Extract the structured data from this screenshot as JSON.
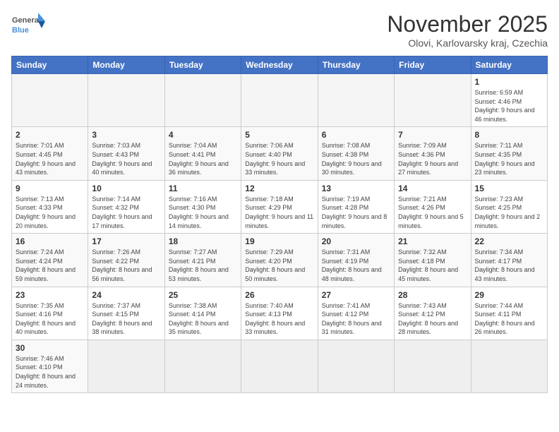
{
  "header": {
    "logo_general": "General",
    "logo_blue": "Blue",
    "month": "November 2025",
    "location": "Olovi, Karlovarsky kraj, Czechia"
  },
  "days_of_week": [
    "Sunday",
    "Monday",
    "Tuesday",
    "Wednesday",
    "Thursday",
    "Friday",
    "Saturday"
  ],
  "weeks": [
    [
      {
        "day": "",
        "info": ""
      },
      {
        "day": "",
        "info": ""
      },
      {
        "day": "",
        "info": ""
      },
      {
        "day": "",
        "info": ""
      },
      {
        "day": "",
        "info": ""
      },
      {
        "day": "",
        "info": ""
      },
      {
        "day": "1",
        "info": "Sunrise: 6:59 AM\nSunset: 4:46 PM\nDaylight: 9 hours and 46 minutes."
      }
    ],
    [
      {
        "day": "2",
        "info": "Sunrise: 7:01 AM\nSunset: 4:45 PM\nDaylight: 9 hours and 43 minutes."
      },
      {
        "day": "3",
        "info": "Sunrise: 7:03 AM\nSunset: 4:43 PM\nDaylight: 9 hours and 40 minutes."
      },
      {
        "day": "4",
        "info": "Sunrise: 7:04 AM\nSunset: 4:41 PM\nDaylight: 9 hours and 36 minutes."
      },
      {
        "day": "5",
        "info": "Sunrise: 7:06 AM\nSunset: 4:40 PM\nDaylight: 9 hours and 33 minutes."
      },
      {
        "day": "6",
        "info": "Sunrise: 7:08 AM\nSunset: 4:38 PM\nDaylight: 9 hours and 30 minutes."
      },
      {
        "day": "7",
        "info": "Sunrise: 7:09 AM\nSunset: 4:36 PM\nDaylight: 9 hours and 27 minutes."
      },
      {
        "day": "8",
        "info": "Sunrise: 7:11 AM\nSunset: 4:35 PM\nDaylight: 9 hours and 23 minutes."
      }
    ],
    [
      {
        "day": "9",
        "info": "Sunrise: 7:13 AM\nSunset: 4:33 PM\nDaylight: 9 hours and 20 minutes."
      },
      {
        "day": "10",
        "info": "Sunrise: 7:14 AM\nSunset: 4:32 PM\nDaylight: 9 hours and 17 minutes."
      },
      {
        "day": "11",
        "info": "Sunrise: 7:16 AM\nSunset: 4:30 PM\nDaylight: 9 hours and 14 minutes."
      },
      {
        "day": "12",
        "info": "Sunrise: 7:18 AM\nSunset: 4:29 PM\nDaylight: 9 hours and 11 minutes."
      },
      {
        "day": "13",
        "info": "Sunrise: 7:19 AM\nSunset: 4:28 PM\nDaylight: 9 hours and 8 minutes."
      },
      {
        "day": "14",
        "info": "Sunrise: 7:21 AM\nSunset: 4:26 PM\nDaylight: 9 hours and 5 minutes."
      },
      {
        "day": "15",
        "info": "Sunrise: 7:23 AM\nSunset: 4:25 PM\nDaylight: 9 hours and 2 minutes."
      }
    ],
    [
      {
        "day": "16",
        "info": "Sunrise: 7:24 AM\nSunset: 4:24 PM\nDaylight: 8 hours and 59 minutes."
      },
      {
        "day": "17",
        "info": "Sunrise: 7:26 AM\nSunset: 4:22 PM\nDaylight: 8 hours and 56 minutes."
      },
      {
        "day": "18",
        "info": "Sunrise: 7:27 AM\nSunset: 4:21 PM\nDaylight: 8 hours and 53 minutes."
      },
      {
        "day": "19",
        "info": "Sunrise: 7:29 AM\nSunset: 4:20 PM\nDaylight: 8 hours and 50 minutes."
      },
      {
        "day": "20",
        "info": "Sunrise: 7:31 AM\nSunset: 4:19 PM\nDaylight: 8 hours and 48 minutes."
      },
      {
        "day": "21",
        "info": "Sunrise: 7:32 AM\nSunset: 4:18 PM\nDaylight: 8 hours and 45 minutes."
      },
      {
        "day": "22",
        "info": "Sunrise: 7:34 AM\nSunset: 4:17 PM\nDaylight: 8 hours and 43 minutes."
      }
    ],
    [
      {
        "day": "23",
        "info": "Sunrise: 7:35 AM\nSunset: 4:16 PM\nDaylight: 8 hours and 40 minutes."
      },
      {
        "day": "24",
        "info": "Sunrise: 7:37 AM\nSunset: 4:15 PM\nDaylight: 8 hours and 38 minutes."
      },
      {
        "day": "25",
        "info": "Sunrise: 7:38 AM\nSunset: 4:14 PM\nDaylight: 8 hours and 35 minutes."
      },
      {
        "day": "26",
        "info": "Sunrise: 7:40 AM\nSunset: 4:13 PM\nDaylight: 8 hours and 33 minutes."
      },
      {
        "day": "27",
        "info": "Sunrise: 7:41 AM\nSunset: 4:12 PM\nDaylight: 8 hours and 31 minutes."
      },
      {
        "day": "28",
        "info": "Sunrise: 7:43 AM\nSunset: 4:12 PM\nDaylight: 8 hours and 28 minutes."
      },
      {
        "day": "29",
        "info": "Sunrise: 7:44 AM\nSunset: 4:11 PM\nDaylight: 8 hours and 26 minutes."
      }
    ],
    [
      {
        "day": "30",
        "info": "Sunrise: 7:46 AM\nSunset: 4:10 PM\nDaylight: 8 hours and 24 minutes."
      },
      {
        "day": "",
        "info": ""
      },
      {
        "day": "",
        "info": ""
      },
      {
        "day": "",
        "info": ""
      },
      {
        "day": "",
        "info": ""
      },
      {
        "day": "",
        "info": ""
      },
      {
        "day": "",
        "info": ""
      }
    ]
  ]
}
